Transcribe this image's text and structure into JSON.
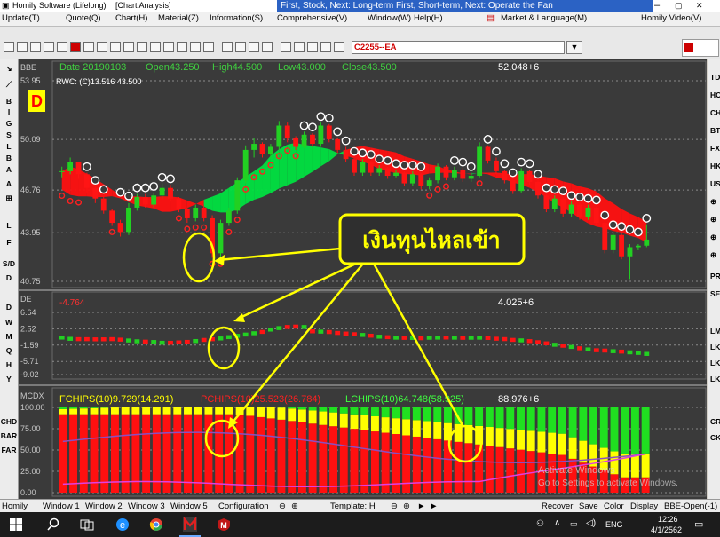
{
  "titlebar": {
    "app_title": "Homily Software (Lifelong)",
    "window_title": "[Chart Analysis]",
    "marquee_text": "First, Stock, Next: Long-term First, Short-term, Next: Operate the Fan"
  },
  "menubar": {
    "items": [
      "Update(T)",
      "Quote(Q)",
      "Chart(H)",
      "Material(Z)",
      "Information(S)",
      "Comprehensive(V)",
      "Window(W)",
      "Help(H)",
      "Market & Language(M)",
      "Homily Video(V)"
    ]
  },
  "toolbar": {
    "stock_code": "C2255--EA"
  },
  "chart_data": [
    {
      "type": "candlestick",
      "panel": "price",
      "title": "BBE",
      "header": {
        "date": "Date 20190103",
        "open": "Open43.250",
        "high": "High44.500",
        "low": "Low43.000",
        "close": "Close43.500",
        "volume": "52.048+6",
        "rwc": "RWC: (C)13.516   43.500"
      },
      "y_ticks": [
        53.95,
        50.09,
        46.76,
        43.95,
        40.75
      ],
      "ylim": [
        40.75,
        53.95
      ],
      "annotation": "เงินทุนไหลเข้า",
      "marker": "D",
      "candles": [
        [
          48.0,
          48.3,
          47.6,
          48.0
        ],
        [
          48.0,
          48.9,
          47.8,
          48.6
        ],
        [
          48.6,
          48.6,
          47.5,
          47.8
        ],
        [
          47.8,
          47.9,
          46.6,
          46.9
        ],
        [
          46.9,
          47.0,
          45.9,
          46.2
        ],
        [
          46.2,
          46.4,
          45.2,
          45.4
        ],
        [
          45.4,
          45.5,
          44.4,
          44.6
        ],
        [
          44.6,
          44.8,
          43.7,
          44.0
        ],
        [
          44.0,
          45.9,
          43.8,
          45.6
        ],
        [
          45.6,
          46.5,
          45.4,
          46.3
        ],
        [
          46.3,
          46.5,
          45.6,
          45.8
        ],
        [
          45.8,
          46.6,
          45.6,
          46.4
        ],
        [
          46.4,
          47.2,
          46.2,
          46.9
        ],
        [
          46.9,
          47.1,
          46.0,
          46.2
        ],
        [
          46.2,
          46.3,
          45.3,
          45.5
        ],
        [
          45.5,
          45.6,
          44.6,
          44.9
        ],
        [
          44.9,
          45.8,
          44.7,
          45.6
        ],
        [
          45.6,
          45.7,
          44.7,
          44.9
        ],
        [
          44.9,
          45.1,
          42.3,
          42.6
        ],
        [
          42.6,
          44.8,
          42.3,
          44.6
        ],
        [
          44.6,
          45.6,
          44.4,
          45.4
        ],
        [
          45.4,
          47.6,
          45.2,
          47.4
        ],
        [
          47.4,
          49.7,
          47.2,
          49.4
        ],
        [
          49.4,
          50.2,
          48.9,
          49.8
        ],
        [
          49.8,
          49.9,
          48.9,
          49.1
        ],
        [
          49.1,
          49.8,
          48.8,
          49.6
        ],
        [
          49.6,
          51.3,
          49.4,
          51.0
        ],
        [
          51.0,
          51.2,
          49.9,
          50.2
        ],
        [
          50.2,
          50.3,
          49.4,
          49.6
        ],
        [
          49.6,
          50.6,
          49.5,
          50.4
        ],
        [
          50.4,
          50.5,
          49.6,
          49.8
        ],
        [
          49.8,
          51.2,
          49.6,
          51.0
        ],
        [
          51.0,
          51.1,
          49.9,
          50.1
        ],
        [
          50.1,
          50.2,
          49.2,
          49.4
        ],
        [
          49.4,
          49.6,
          48.6,
          48.8
        ],
        [
          48.8,
          48.9,
          47.7,
          47.9
        ],
        [
          47.9,
          48.8,
          47.7,
          48.6
        ],
        [
          48.6,
          48.7,
          47.7,
          47.9
        ],
        [
          47.9,
          48.4,
          47.7,
          48.2
        ],
        [
          48.2,
          48.3,
          47.5,
          47.7
        ],
        [
          47.7,
          48.1,
          47.6,
          47.9
        ],
        [
          47.9,
          48.0,
          47.0,
          47.2
        ],
        [
          47.2,
          48.0,
          47.0,
          47.8
        ],
        [
          47.8,
          47.9,
          46.8,
          47.0
        ],
        [
          47.0,
          47.6,
          46.8,
          47.4
        ],
        [
          47.4,
          48.5,
          47.2,
          48.3
        ],
        [
          48.3,
          48.4,
          47.4,
          47.6
        ],
        [
          47.6,
          48.3,
          47.4,
          48.1
        ],
        [
          48.1,
          48.2,
          47.3,
          47.5
        ],
        [
          47.5,
          47.9,
          47.3,
          47.7
        ],
        [
          47.7,
          49.9,
          47.6,
          49.6
        ],
        [
          49.6,
          49.7,
          48.5,
          48.7
        ],
        [
          48.7,
          48.9,
          47.8,
          48.0
        ],
        [
          48.0,
          48.1,
          47.2,
          47.4
        ],
        [
          47.4,
          47.5,
          46.5,
          46.7
        ],
        [
          46.7,
          48.2,
          46.6,
          48.0
        ],
        [
          48.0,
          48.1,
          47.1,
          47.3
        ],
        [
          47.3,
          47.4,
          46.2,
          46.4
        ],
        [
          46.4,
          46.5,
          45.3,
          45.5
        ],
        [
          45.5,
          46.4,
          45.3,
          46.2
        ],
        [
          46.2,
          46.3,
          45.0,
          45.2
        ],
        [
          45.2,
          46.0,
          45.0,
          45.8
        ],
        [
          45.8,
          45.9,
          44.8,
          45.0
        ],
        [
          45.0,
          45.8,
          44.8,
          45.6
        ],
        [
          45.6,
          45.7,
          44.4,
          44.6
        ],
        [
          44.6,
          44.7,
          42.6,
          42.8
        ],
        [
          42.8,
          44.0,
          42.6,
          43.8
        ],
        [
          43.8,
          43.9,
          42.2,
          42.4
        ],
        [
          42.4,
          43.2,
          40.9,
          43.0
        ],
        [
          43.0,
          43.2,
          42.8,
          43.1
        ],
        [
          43.1,
          44.5,
          43.0,
          43.5
        ]
      ]
    },
    {
      "type": "bar",
      "panel": "indicator",
      "title": "DE",
      "left_value": "-4.764",
      "right_value": "4.025+6",
      "y_ticks": [
        6.64,
        2.52,
        -1.59,
        -5.71,
        -9.02
      ],
      "ylim": [
        -9.02,
        6.64
      ]
    },
    {
      "type": "area",
      "panel": "chips",
      "title": "MCDX",
      "series": [
        {
          "name": "FCHIPS(10)9.729(14.291)",
          "color": "#ffff00"
        },
        {
          "name": "PCHIPS(10)25.523(26.784)",
          "color": "#ff0000"
        },
        {
          "name": "LCHIPS(10)64.748(58.925)",
          "color": "#00ff00"
        }
      ],
      "right_value": "88.976+6",
      "y_ticks": [
        100.0,
        75.0,
        50.0,
        25.0,
        0.0
      ],
      "ylim": [
        0,
        100
      ]
    }
  ],
  "leftbar": {
    "labels": [
      "B",
      "I",
      "G",
      "S",
      "L",
      "B",
      "A",
      "A",
      "L",
      "F",
      "S/D",
      "D",
      "W",
      "M",
      "Q",
      "H",
      "Y",
      "CHD",
      "BAR",
      "FAR"
    ]
  },
  "rightbar": {
    "labels": [
      "TD",
      "HO",
      "CH",
      "BT",
      "FX",
      "HK",
      "US",
      "PR",
      "SE",
      "LM",
      "LK",
      "LK",
      "LK",
      "CR",
      "CK"
    ]
  },
  "tabbar": {
    "items": [
      "Homily",
      "Window 1",
      "Window 2",
      "Window 3",
      "Window 5",
      "Configuration",
      "Template: H",
      "Recover",
      "Save",
      "Color",
      "Display",
      "BBE-Open(-1)"
    ]
  },
  "watermark": {
    "line1": "Activate Windows",
    "line2": "Go to Settings to activate Windows."
  },
  "taskbar": {
    "language": "ENG",
    "time": "12:26",
    "date": "4/1/2562"
  }
}
